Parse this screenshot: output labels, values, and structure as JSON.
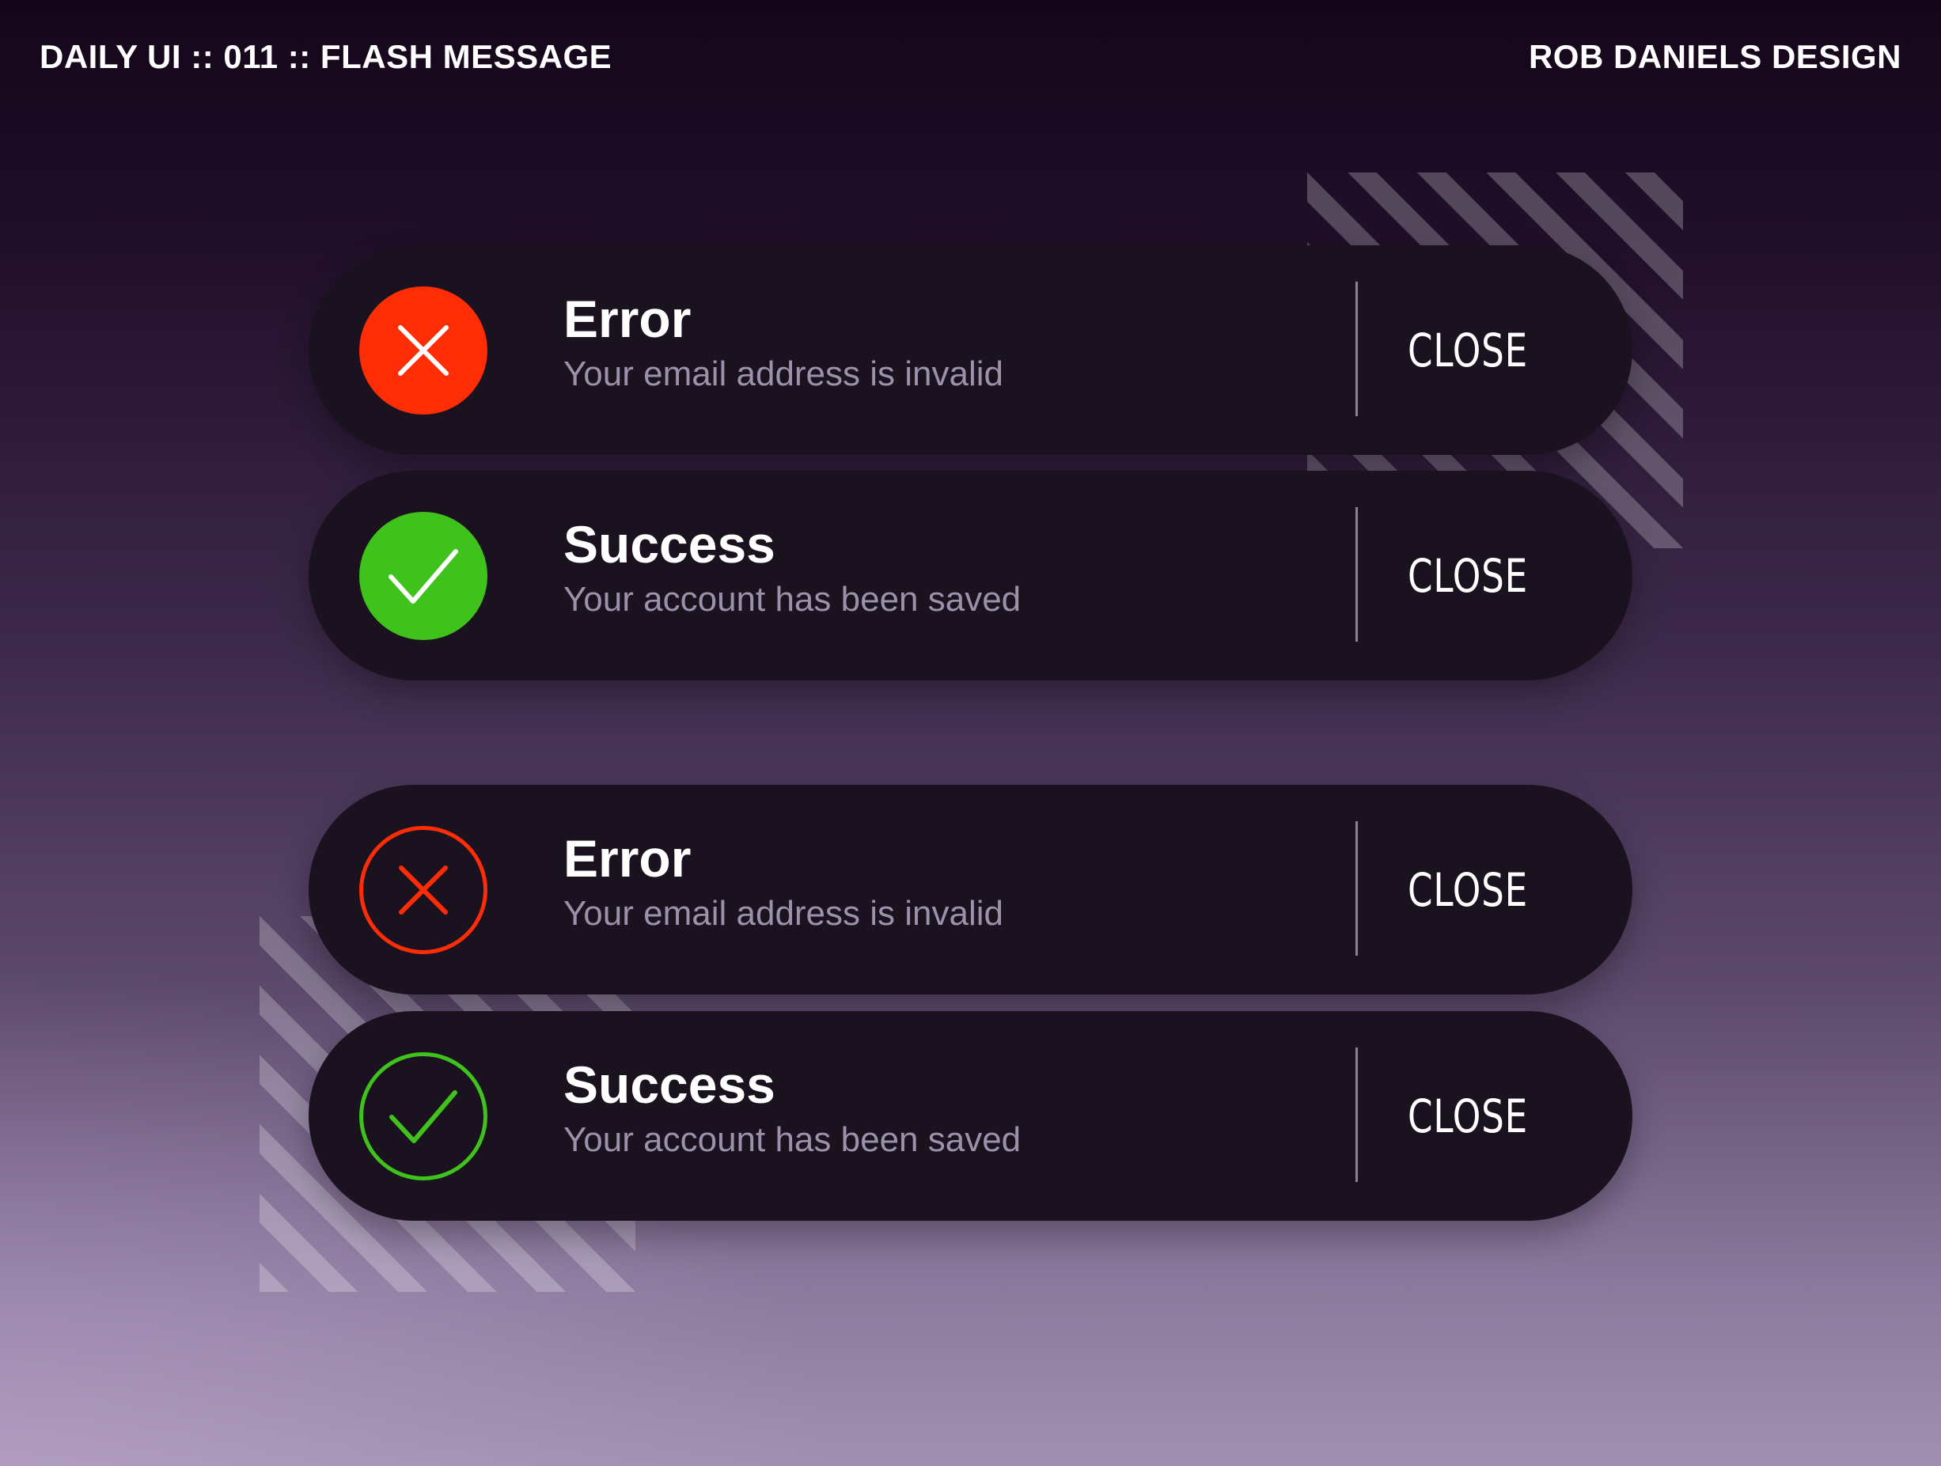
{
  "header": {
    "left_title": "DAILY UI :: 011 :: FLASH MESSAGE",
    "right_title": "ROB DANIELS DESIGN"
  },
  "colors": {
    "error": "#ff2d05",
    "success": "#3fc21b",
    "panel": "#1a121f",
    "message_text": "#9b91ab"
  },
  "messages": [
    {
      "variant": "solid",
      "type": "error",
      "icon": "close-icon",
      "title": "Error",
      "message": "Your email address is invalid",
      "close_label": "CLOSE"
    },
    {
      "variant": "solid",
      "type": "success",
      "icon": "check-icon",
      "title": "Success",
      "message": "Your account has been saved",
      "close_label": "CLOSE"
    },
    {
      "variant": "outline",
      "type": "error",
      "icon": "close-icon",
      "title": "Error",
      "message": "Your email address is invalid",
      "close_label": "CLOSE"
    },
    {
      "variant": "outline",
      "type": "success",
      "icon": "check-icon",
      "title": "Success",
      "message": "Your account has been saved",
      "close_label": "CLOSE"
    }
  ]
}
